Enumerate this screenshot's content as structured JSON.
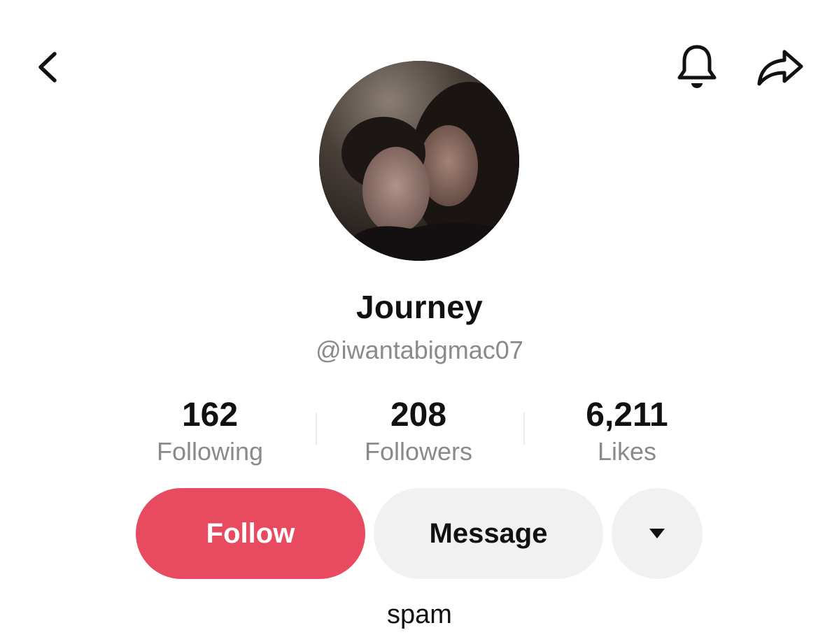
{
  "header": {
    "back_icon": "chevron-left-icon",
    "notification_icon": "bell-icon",
    "share_icon": "share-arrow-icon"
  },
  "profile": {
    "display_name": "Journey",
    "username": "@iwantabigmac07",
    "bio": "spam"
  },
  "stats": [
    {
      "value": "162",
      "label": "Following"
    },
    {
      "value": "208",
      "label": "Followers"
    },
    {
      "value": "6,211",
      "label": "Likes"
    }
  ],
  "actions": {
    "follow_label": "Follow",
    "message_label": "Message",
    "more_icon": "caret-down-icon"
  },
  "colors": {
    "follow_button": "#e84a5f",
    "secondary_button": "#f1f1f1",
    "muted_text": "#8a8a8a"
  }
}
